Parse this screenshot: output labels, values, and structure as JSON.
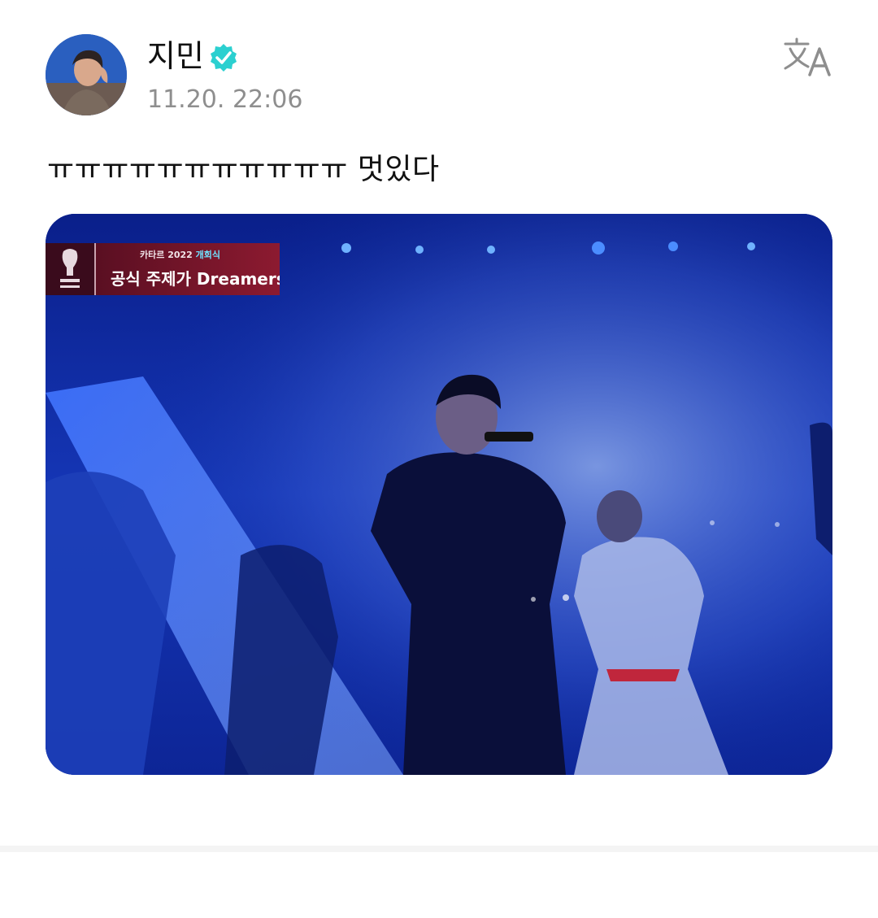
{
  "post": {
    "author": {
      "name": "지민",
      "verified_icon": "verified-badge-icon",
      "avatar_icon": "profile-photo"
    },
    "timestamp": "11.20. 22:06",
    "translate_icon": "translate-icon",
    "text": "ㅠㅠㅠㅠㅠㅠㅠㅠㅠㅠㅠ 멋있다",
    "media": {
      "type": "photo",
      "banner": {
        "line1_prefix": "카타르 2022",
        "line1_accent": "개회식",
        "title": "공식 주제가 Dreamers"
      }
    }
  },
  "colors": {
    "verified": "#2bd0d0",
    "timestamp": "#8e8e8e",
    "media_bg": "#0b2aa0",
    "banner": "#8c1a30"
  }
}
